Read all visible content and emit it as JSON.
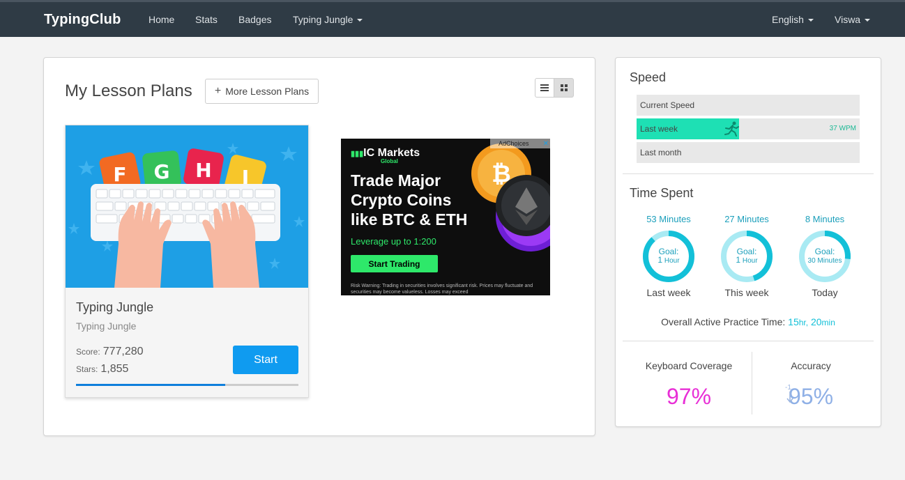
{
  "nav": {
    "brand": "TypingClub",
    "links": [
      "Home",
      "Stats",
      "Badges"
    ],
    "dropdown": "Typing Jungle",
    "language": "English",
    "user": "Viswa"
  },
  "lessons": {
    "title": "My Lesson Plans",
    "more_button": "More Lesson Plans",
    "card": {
      "title": "Typing Jungle",
      "subtitle": "Typing Jungle",
      "score_label": "Score:",
      "score": "777,280",
      "stars_label": "Stars:",
      "stars": "1,855",
      "start": "Start",
      "progress_fraction": 0.67,
      "image_letters": [
        "F",
        "G",
        "H",
        "J"
      ]
    }
  },
  "ad": {
    "logo": "IC Markets",
    "logo_sub": "Global",
    "headline": "Trade Major Crypto Coins like BTC & ETH",
    "leverage": "Leverage up to 1:200",
    "button": "Start Trading",
    "warning": "Risk Warning: Trading in securities involves significant risk. Prices may fluctuate and securities may become valueless. Losses may exceed",
    "choices": "AdChoices"
  },
  "speed": {
    "title": "Speed",
    "rows": [
      {
        "label": "Current Speed",
        "fill": 0,
        "wpm": ""
      },
      {
        "label": "Last week",
        "fill": 0.46,
        "wpm": "37 WPM"
      },
      {
        "label": "Last month",
        "fill": 0,
        "wpm": ""
      }
    ]
  },
  "time": {
    "title": "Time Spent",
    "rings": [
      {
        "top": "53 Minutes",
        "goal_label": "Goal:",
        "goal_num": "1",
        "goal_unit": "Hour",
        "bottom": "Last week",
        "fraction": 0.883
      },
      {
        "top": "27 Minutes",
        "goal_label": "Goal:",
        "goal_num": "1",
        "goal_unit": "Hour",
        "bottom": "This week",
        "fraction": 0.45
      },
      {
        "top": "8 Minutes",
        "goal_label": "Goal:",
        "goal_num": "",
        "goal_unit": "30 Minutes",
        "bottom": "Today",
        "fraction": 0.267
      }
    ],
    "overall_label": "Overall Active Practice Time:",
    "overall_hr": "15",
    "overall_hr_unit": "hr,",
    "overall_min": "20",
    "overall_min_unit": "min"
  },
  "coverage": {
    "label": "Keyboard Coverage",
    "value": "97%"
  },
  "accuracy": {
    "label": "Accuracy",
    "value": "95%",
    "delta": "-1"
  },
  "colors": {
    "navbar": "#2f3b45",
    "accent_blue": "#0f9bf0",
    "speed_fill": "#1ee0b4",
    "ring": "#13c0d8",
    "coverage": "#e82fd6",
    "accuracy": "#8fb0e6"
  }
}
